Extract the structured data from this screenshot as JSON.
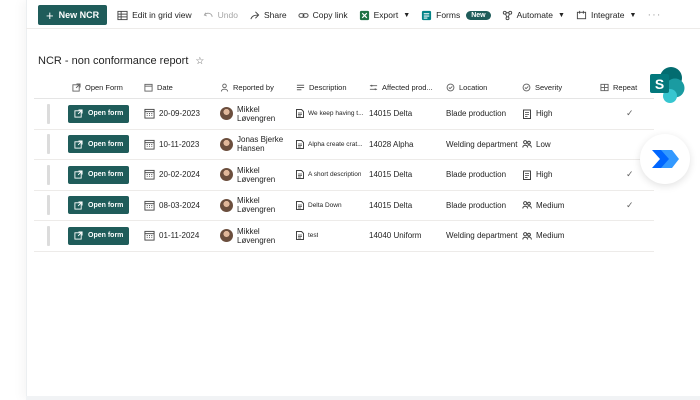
{
  "toolbar": {
    "new_label": "New NCR",
    "edit_grid_label": "Edit in grid view",
    "undo_label": "Undo",
    "share_label": "Share",
    "copy_link_label": "Copy link",
    "export_label": "Export",
    "forms_label": "Forms",
    "forms_badge": "New",
    "automate_label": "Automate",
    "integrate_label": "Integrate",
    "more_label": "···"
  },
  "page": {
    "title": "NCR - non conformance report",
    "star": "☆"
  },
  "columns": {
    "open_form": "Open Form",
    "date": "Date",
    "reported_by": "Reported by",
    "description": "Description",
    "affected": "Affected prod...",
    "location": "Location",
    "severity": "Severity",
    "repeat": "Repeat"
  },
  "open_button_label": "Open form",
  "rows": [
    {
      "date": "20-09-2023",
      "reporter": "Mikkel Løvengren",
      "description": "We keep having t...",
      "affected": "14015 Delta",
      "location": "Blade production",
      "severity": "High",
      "repeat": "✓"
    },
    {
      "date": "10-11-2023",
      "reporter": "Jonas Bjerke Hansen",
      "description": "Alpha create crat...",
      "affected": "14028 Alpha",
      "location": "Welding department",
      "severity": "Low",
      "repeat": ""
    },
    {
      "date": "20-02-2024",
      "reporter": "Mikkel Løvengren",
      "description": "A short description",
      "affected": "14015 Delta",
      "location": "Blade production",
      "severity": "High",
      "repeat": "✓"
    },
    {
      "date": "08-03-2024",
      "reporter": "Mikkel Løvengren",
      "description": "Delta Down",
      "affected": "14015 Delta",
      "location": "Blade production",
      "severity": "Medium",
      "repeat": "✓"
    },
    {
      "date": "01-11-2024",
      "reporter": "Mikkel Løvengren",
      "description": "test",
      "affected": "14040 Uniform",
      "location": "Welding department",
      "severity": "Medium",
      "repeat": ""
    }
  ],
  "colors": {
    "accent": "#1f5c5a",
    "sharepoint": "#038387",
    "power_automate": "#0f6cbd"
  },
  "icons": {
    "severity_high": "clipboard-icon",
    "severity_low": "people-icon",
    "severity_medium": "people-icon",
    "apps": [
      "sharepoint-icon",
      "power-automate-icon"
    ]
  }
}
